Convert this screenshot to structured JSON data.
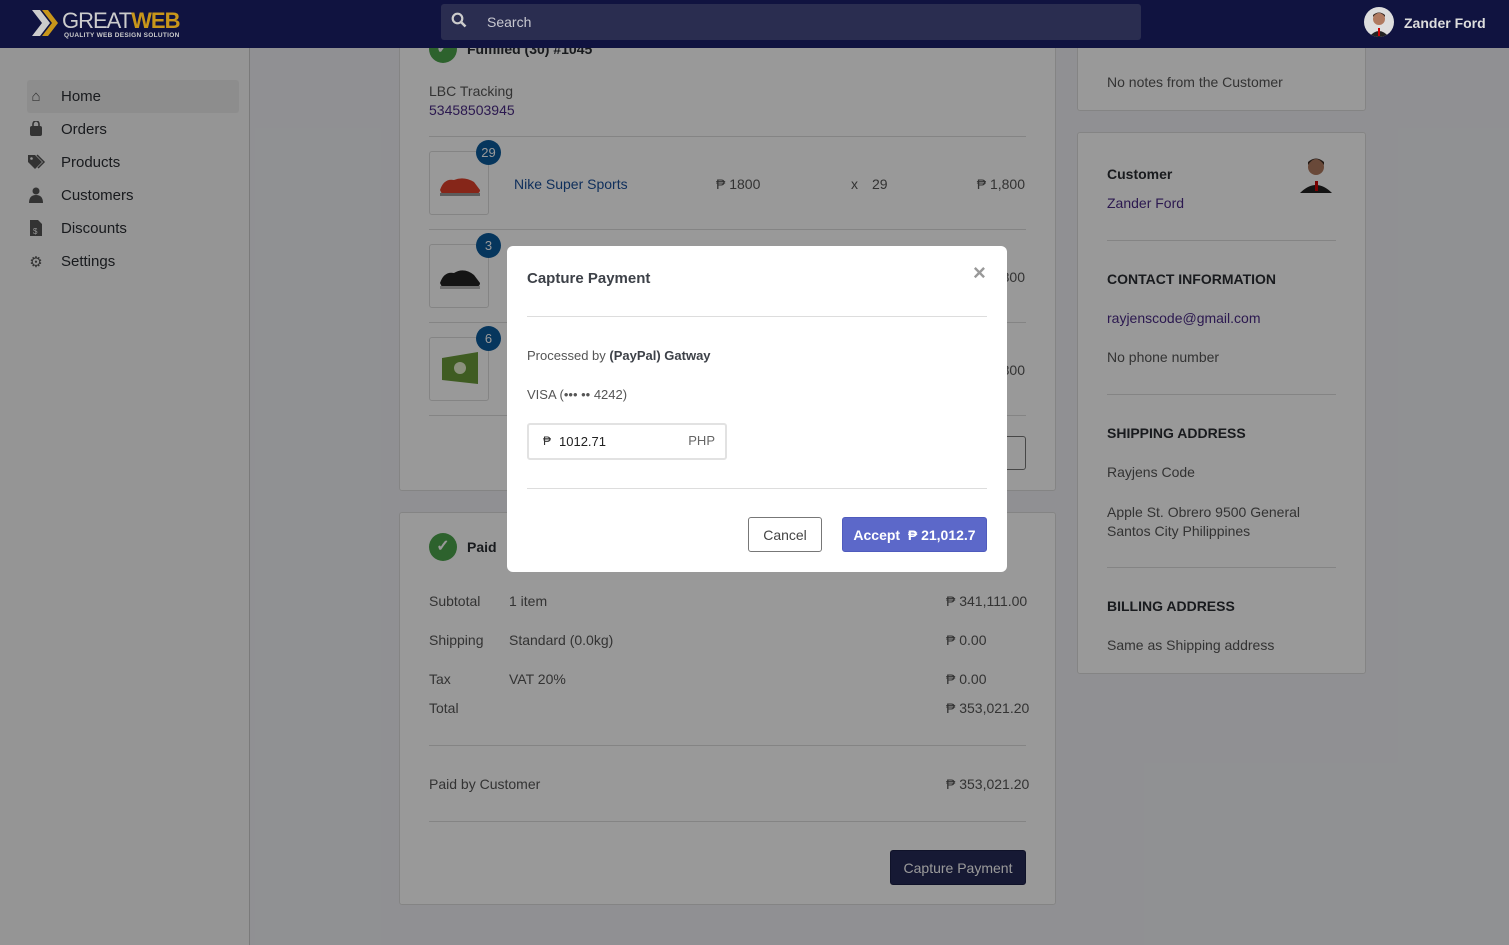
{
  "header": {
    "logo_text_1": "GREAT",
    "logo_text_2": "WEB",
    "logo_tagline": "QUALITY WEB DESIGN SOLUTION",
    "search_placeholder": "Search",
    "user_name": "Zander Ford"
  },
  "sidebar": {
    "items": [
      {
        "label": "Home",
        "icon": "home-icon",
        "active": true
      },
      {
        "label": "Orders",
        "icon": "shopping-bag-icon"
      },
      {
        "label": "Products",
        "icon": "tags-icon"
      },
      {
        "label": "Customers",
        "icon": "user-icon"
      },
      {
        "label": "Discounts",
        "icon": "file-invoice-dollar-icon"
      },
      {
        "label": "Settings",
        "icon": "gear-icon"
      }
    ]
  },
  "fulfilled": {
    "title": "Fulfilled (30) #1045",
    "tracking_label": "LBC Tracking",
    "tracking_number": "53458503945",
    "items": [
      {
        "qty_badge": "29",
        "name": "Nike Super Sports",
        "price": "₱ 1800",
        "x": "x",
        "qty": "29",
        "total": "₱ 1,800"
      },
      {
        "qty_badge": "3",
        "total": "₱ 1,800"
      },
      {
        "qty_badge": "6",
        "total": "₱ 1,800"
      }
    ]
  },
  "payment": {
    "status": "Paid",
    "rows": [
      {
        "label": "Subtotal",
        "detail": "1 item",
        "amount": "₱ 341,111.00"
      },
      {
        "label": "Shipping",
        "detail": "Standard (0.0kg)",
        "amount": "₱ 0.00"
      },
      {
        "label": "Tax",
        "detail": "VAT 20%",
        "amount": "₱ 0.00"
      },
      {
        "label": "Total",
        "detail": "",
        "amount": "₱ 353,021.20"
      }
    ],
    "paid_by_label": "Paid by Customer",
    "paid_by_amount": "₱ 353,021.20",
    "capture_button": "Capture Payment"
  },
  "notes": {
    "text": "No notes from the Customer"
  },
  "customer": {
    "title": "Customer",
    "name": "Zander Ford",
    "contact_title": "CONTACT INFORMATION",
    "email": "rayjenscode@gmail.com",
    "phone": "No phone number",
    "shipping_title": "SHIPPING ADDRESS",
    "shipping_name": "Rayjens Code",
    "shipping_address": "Apple St. Obrero 9500 General Santos City Philippines",
    "billing_title": "BILLING ADDRESS",
    "billing_text": "Same as Shipping address"
  },
  "modal": {
    "title": "Capture Payment",
    "processed_prefix": "Processed by ",
    "processed_gateway": "(PayPal) Gatway",
    "card": "VISA (••• •• 4242)",
    "currency_symbol": "₱",
    "amount": "1012.71",
    "currency": "PHP",
    "cancel": "Cancel",
    "accept": "Accept  ₱ 21,012.7"
  },
  "colors": {
    "header_bg": "#101340",
    "accent": "#5c68c9",
    "paid_green": "#4ca34c",
    "badge_blue": "#0b5a9c"
  }
}
